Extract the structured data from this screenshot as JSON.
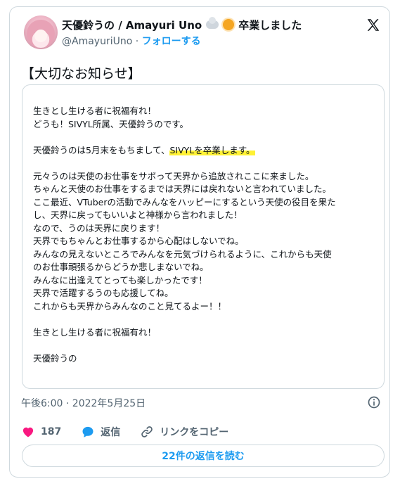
{
  "author": {
    "display_name": "天優鈴うの / Amayuri Uno",
    "emoji_1": "cloud-emoji",
    "emoji_2": "sun-emoji",
    "status": "卒業しました",
    "handle": "@AmayuriUno",
    "separator": "·",
    "follow_label": "フォローする"
  },
  "headline": "【大切なお知らせ】",
  "image_text": {
    "lines": [
      "生きとし生ける者に祝福有れ！",
      "どうも！SIVYL所属、天優鈴うのです。",
      "",
      {
        "pre": " 天優鈴うのは5月末をもちまして、",
        "highlight": "SIVYLを卒業します。"
      },
      "",
      "元々うのは天使のお仕事をサボって天界から追放されここに来ました。",
      "ちゃんと天使のお仕事をするまでは天界には戻れないと言われていました。",
      "ここ最近、VTuberの活動でみんなをハッピーにするという天使の役目を果た",
      "し、天界に戻ってもいいよと神様から言われました！",
      "なので、うのは天界に戻ります！",
      "天界でもちゃんとお仕事するから心配はしないでね。",
      "みんなの見えないところでみんなを元気づけられるように、これからも天使",
      "のお仕事頑張るからどうか悲しまないでね。",
      "みんなに出逢えてとっても楽しかったです！",
      "天界で活躍するうのも応援してね。",
      "これからも天界からみんなのこと見てるよー！！",
      "",
      "生きとし生ける者に祝福有れ！",
      "",
      " 天優鈴うの"
    ],
    "highlight_color": "#fff134"
  },
  "timestamp": "午後6:00 · 2022年5月25日",
  "actions": {
    "like_count": "187",
    "reply_label": "返信",
    "copy_link_label": "リンクをコピー"
  },
  "read_replies_label": "22件の返信を読む",
  "colors": {
    "accent": "#1d9bf0",
    "like": "#f91880",
    "secondary_text": "#536471",
    "border": "#cfd9de"
  }
}
